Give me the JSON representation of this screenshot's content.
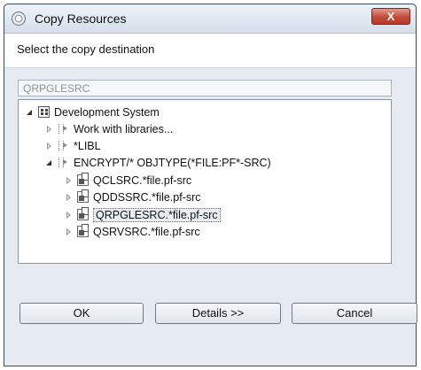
{
  "window": {
    "title": "Copy Resources",
    "close_label": "X"
  },
  "header": {
    "text": "Select the copy destination"
  },
  "destination": {
    "value": "QRPGLESRC"
  },
  "tree": {
    "root": {
      "label": "Development System",
      "icon": "system-icon",
      "expanded": true
    },
    "filters": [
      {
        "label": "Work with libraries...",
        "icon": "filter-icon",
        "expanded": false
      },
      {
        "label": "*LIBL",
        "icon": "filter-icon",
        "expanded": false
      },
      {
        "label": "ENCRYPT/* OBJTYPE(*FILE:PF*-SRC)",
        "icon": "filter-icon",
        "expanded": true
      }
    ],
    "files": [
      {
        "label": "QCLSRC.*file.pf-src",
        "icon": "source-file-icon",
        "selected": false
      },
      {
        "label": "QDDSSRC.*file.pf-src",
        "icon": "source-file-icon",
        "selected": false
      },
      {
        "label": "QRPGLESRC.*file.pf-src",
        "icon": "source-file-icon",
        "selected": true
      },
      {
        "label": "QSRVSRC.*file.pf-src",
        "icon": "source-file-icon",
        "selected": false
      }
    ]
  },
  "buttons": {
    "ok": "OK",
    "details": "Details >>",
    "cancel": "Cancel"
  }
}
